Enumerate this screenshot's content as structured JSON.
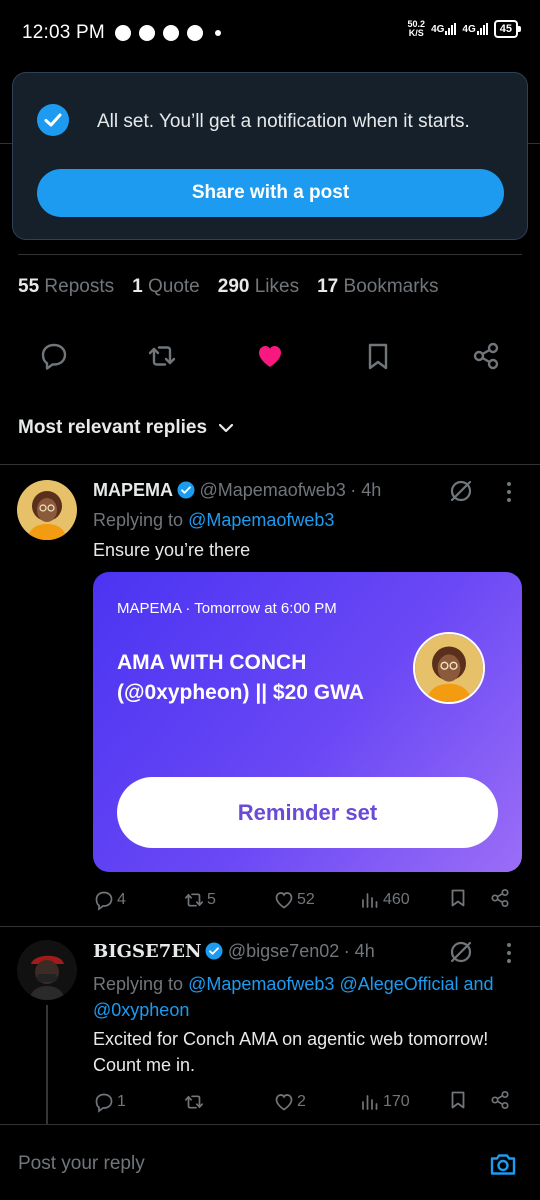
{
  "status_bar": {
    "time": "12:03 PM",
    "net_speed": "50.2",
    "net_unit": "K/S",
    "net1": "4G",
    "net2": "4G",
    "battery": "45"
  },
  "toast": {
    "message": "All set. You’ll get a notification when it starts.",
    "share_label": "Share with a post"
  },
  "stats": [
    {
      "count": "55",
      "label": "Reposts"
    },
    {
      "count": "1",
      "label": "Quote"
    },
    {
      "count": "290",
      "label": "Likes"
    },
    {
      "count": "17",
      "label": "Bookmarks"
    }
  ],
  "actions": {
    "reply_icon": "reply-icon",
    "repost_icon": "repost-icon",
    "like_icon": "heart-filled-icon",
    "bookmark_icon": "bookmark-icon",
    "share_icon": "share-icon",
    "like_color": "#f91880"
  },
  "replies_header": {
    "label": "Most relevant replies"
  },
  "reply1": {
    "name": "MAPEMA",
    "handle": "@Mapemaofweb3",
    "time": "· 4h",
    "replying_prefix": "Replying to",
    "replying_to": "@Mapemaofweb3",
    "text": "Ensure you’re there",
    "card": {
      "meta": "MAPEMA · Tomorrow at 6:00 PM",
      "title": "AMA WITH CONCH (@0xypheon) || $20 GWA",
      "button": "Reminder set"
    },
    "replies": "4",
    "reposts": "5",
    "likes": "52",
    "views": "460"
  },
  "reply2": {
    "name": "BIGSE7EN",
    "handle": "@bigse7en02",
    "time": "· 4h",
    "replying_prefix": "Replying to",
    "replying_to_1": "@Mapemaofweb3",
    "replying_to_2": "@AlegeOfficial",
    "replying_and": "and",
    "replying_to_3": "@0xypheon",
    "text": "Excited for Conch AMA on agentic web tomorrow! Count me in.",
    "replies": "1",
    "reposts": "",
    "likes": "2",
    "views": "170"
  },
  "composer": {
    "placeholder": "Post your reply"
  },
  "colors": {
    "accent": "#1d9bf0",
    "muted": "#71767b",
    "background": "#000000"
  }
}
